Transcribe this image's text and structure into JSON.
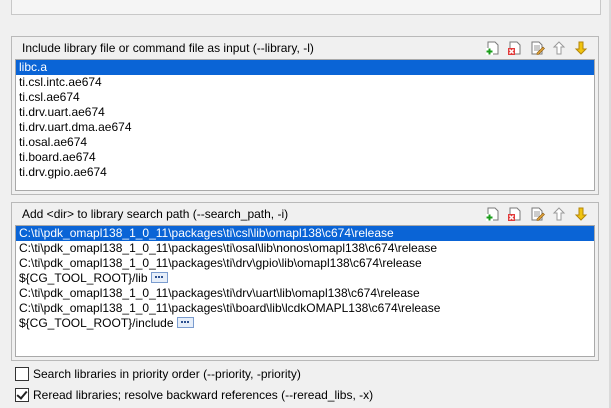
{
  "libraries_group": {
    "title": "Include library file or command file as input (--library, -l)",
    "items": [
      "libc.a",
      "ti.csl.intc.ae674",
      "ti.csl.ae674",
      "ti.drv.uart.ae674",
      "ti.drv.uart.dma.ae674",
      "ti.osal.ae674",
      "ti.board.ae674",
      "ti.drv.gpio.ae674"
    ]
  },
  "search_path_group": {
    "title": "Add <dir> to library search path (--search_path, -i)",
    "items": [
      "C:\\ti\\pdk_omapl138_1_0_11\\packages\\ti\\csl\\lib\\omapl138\\c674\\release",
      "C:\\ti\\pdk_omapl138_1_0_11\\packages\\ti\\osal\\lib\\nonos\\omapl138\\c674\\release",
      "C:\\ti\\pdk_omapl138_1_0_11\\packages\\ti\\drv\\gpio\\lib\\omapl138\\c674\\release",
      "${CG_TOOL_ROOT}/lib",
      "C:\\ti\\pdk_omapl138_1_0_11\\packages\\ti\\drv\\uart\\lib\\omapl138\\c674\\release",
      "C:\\ti\\pdk_omapl138_1_0_11\\packages\\ti\\board\\lib\\lcdkOMAPL138\\c674\\release",
      "${CG_TOOL_ROOT}/include"
    ]
  },
  "options": {
    "priority_label": "Search libraries in priority order (--priority, -priority)",
    "reread_label": "Reread libraries; resolve backward references (--reread_libs, -x)"
  },
  "toolbar_icons": [
    "add-icon",
    "delete-icon",
    "edit-icon",
    "move-up-icon",
    "move-down-icon"
  ]
}
